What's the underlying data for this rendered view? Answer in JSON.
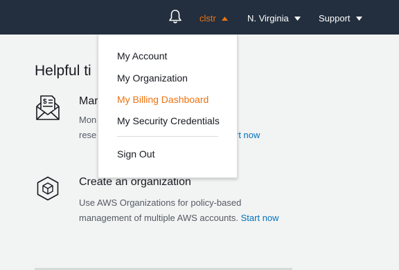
{
  "topbar": {
    "user_label": "clstr",
    "region_label": "N. Virginia",
    "support_label": "Support",
    "icons": {
      "notifications": "bell-icon",
      "dropdown": "caret-down-icon",
      "dropdown_open": "caret-up-icon"
    }
  },
  "main": {
    "title": "Helpful ti",
    "tips": [
      {
        "icon": "billing-envelope-icon",
        "title": "Mar",
        "desc_line1": "Mon",
        "desc_line2": "rese",
        "link": "rt now"
      },
      {
        "icon": "hexagon-cube-icon",
        "title": "Create an organization",
        "desc": "Use AWS Organizations for policy-based management of multiple AWS accounts. ",
        "link": "Start now"
      }
    ]
  },
  "account_menu": {
    "items": [
      "My Account",
      "My Organization",
      "My Billing Dashboard",
      "My Security Credentials"
    ],
    "active_item": "My Billing Dashboard",
    "sign_out": "Sign Out"
  },
  "colors": {
    "topbar_bg": "#232f3e",
    "accent": "#ec7211",
    "link": "#0073bb",
    "page_bg": "#f2f3f3"
  }
}
